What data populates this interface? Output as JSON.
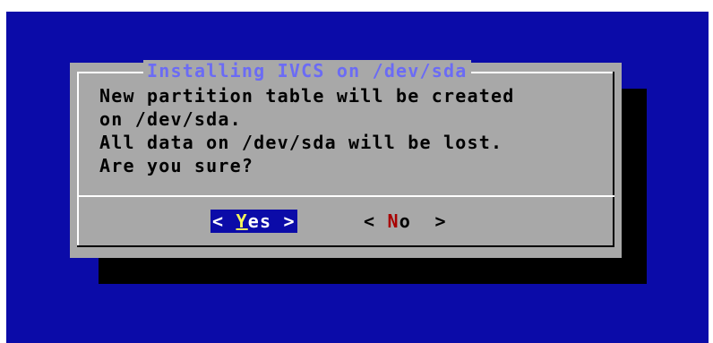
{
  "dialog": {
    "title": "Installing IVCS on /dev/sda",
    "message_lines": [
      "New partition table will be created",
      "on /dev/sda.",
      "All data on /dev/sda will be lost.",
      "Are you sure?"
    ]
  },
  "buttons": {
    "yes": {
      "left_bracket": "< ",
      "hotkey": "Y",
      "rest": "es",
      "right_bracket": " >"
    },
    "no": {
      "left_bracket": "< ",
      "hotkey": "N",
      "rest": "o ",
      "right_bracket": " >"
    }
  },
  "colors": {
    "background": "#0b0ba8",
    "dialog": "#a8a8a8",
    "title": "#6b6bf5",
    "selected_button_bg": "#0b0ba8",
    "yes_hotkey": "#f5f55a",
    "no_hotkey": "#a80000"
  }
}
